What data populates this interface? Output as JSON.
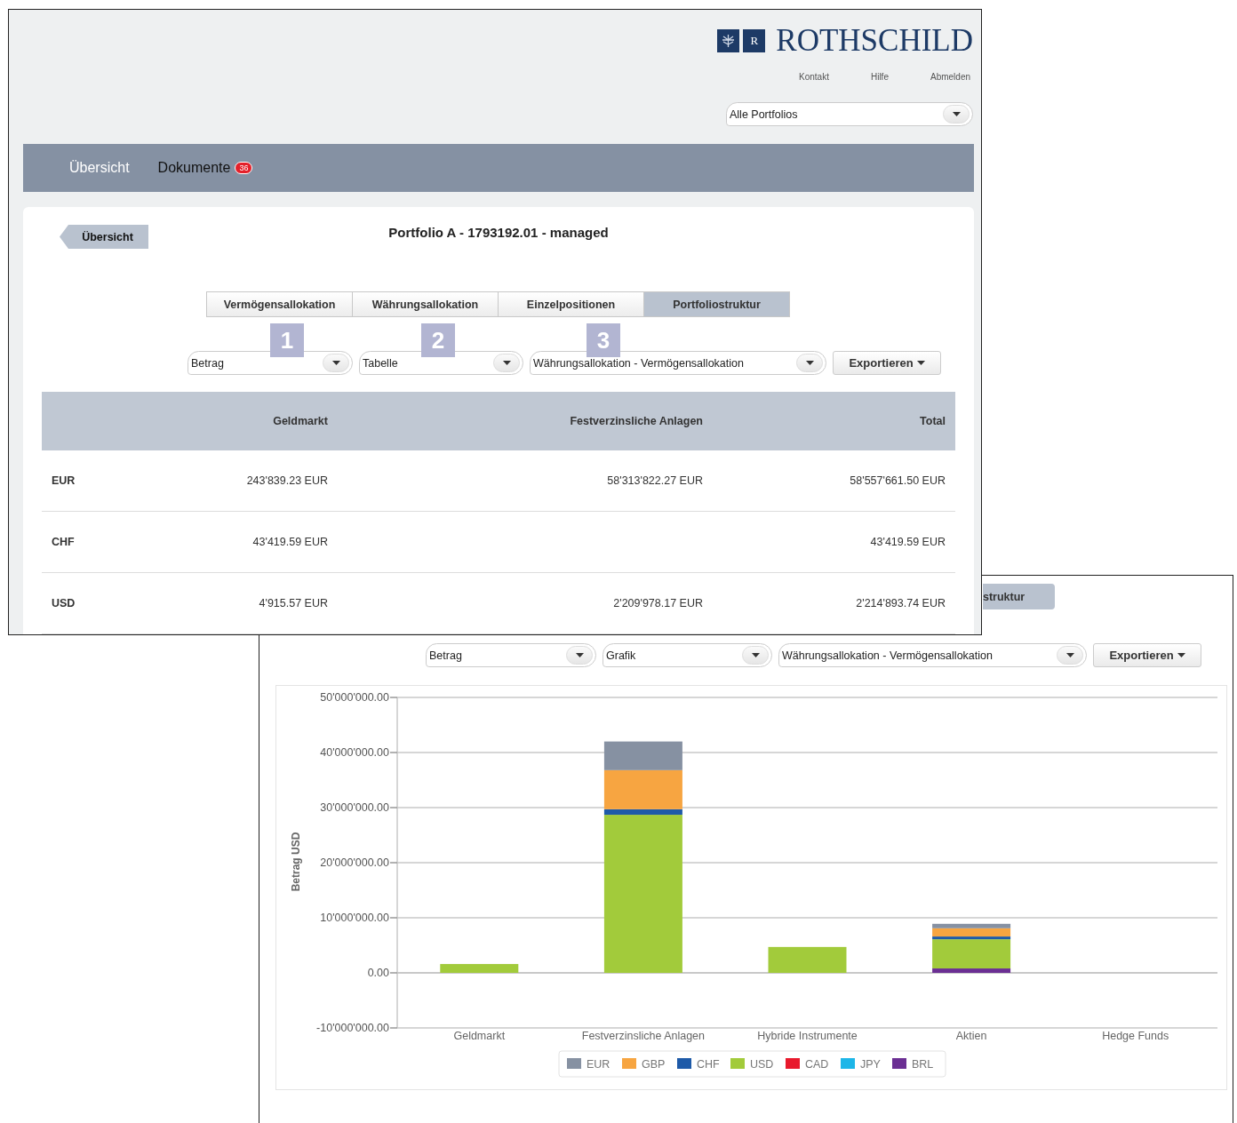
{
  "front_window": {
    "logo": {
      "mark": "R",
      "name": "ROTHSCHILD"
    },
    "top_links": [
      "Kontakt",
      "Hilfe",
      "Abmelden"
    ],
    "portfolio_select": {
      "value": "Alle Portfolios"
    },
    "nav": [
      {
        "label": "Übersicht",
        "selected": true
      },
      {
        "label": "Dokumente",
        "badge": "36",
        "selected": false
      }
    ],
    "back_button": "Übersicht",
    "title": "Portfolio A - 1793192.01 - managed",
    "tabs": [
      {
        "label": "Vermögensallokation",
        "selected": false
      },
      {
        "label": "Währungsallokation",
        "selected": false
      },
      {
        "label": "Einzelpositionen",
        "selected": false
      },
      {
        "label": "Portfoliostruktur",
        "selected": true
      }
    ],
    "markers": [
      "1",
      "2",
      "3"
    ],
    "controls": {
      "selects": [
        "Betrag",
        "Tabelle",
        "Währungsallokation - Vermögensallokation"
      ],
      "export_button": "Exportieren"
    },
    "table": {
      "columns": [
        "",
        "Geldmarkt",
        "Festverzinsliche Anlagen",
        "Total"
      ],
      "rows": [
        [
          "EUR",
          "243'839.23 EUR",
          "58'313'822.27 EUR",
          "58'557'661.50 EUR"
        ],
        [
          "CHF",
          "43'419.59 EUR",
          "",
          "43'419.59 EUR"
        ],
        [
          "USD",
          "4'915.57 EUR",
          "2'209'978.17 EUR",
          "2'214'893.74 EUR"
        ]
      ]
    }
  },
  "back_window": {
    "tab_fragment": {
      "label": "struktur",
      "selected": true
    },
    "controls": {
      "selects": [
        "Betrag",
        "Grafik",
        "Währungsallokation - Vermögensallokation"
      ],
      "export_button": "Exportieren"
    },
    "chart_data": {
      "type": "bar",
      "stacked": true,
      "grid": true,
      "legend": true,
      "ylabel": "Betrag USD",
      "categories": [
        "Geldmarkt",
        "Festverzinsliche Anlagen",
        "Hybride Instrumente",
        "Aktien",
        "Hedge Funds"
      ],
      "series": [
        {
          "name": "EUR",
          "color": "#8691a2",
          "values": [
            0,
            5200000,
            0,
            800000,
            0
          ]
        },
        {
          "name": "GBP",
          "color": "#f7a541",
          "values": [
            0,
            7100000,
            0,
            1500000,
            0
          ]
        },
        {
          "name": "CHF",
          "color": "#1e5aa8",
          "values": [
            0,
            1000000,
            0,
            500000,
            0
          ]
        },
        {
          "name": "USD",
          "color": "#a2cb3b",
          "values": [
            1600000,
            28700000,
            4700000,
            5300000,
            0
          ]
        },
        {
          "name": "CAD",
          "color": "#e8192c",
          "values": [
            0,
            0,
            0,
            0,
            0
          ]
        },
        {
          "name": "JPY",
          "color": "#1db6e8",
          "values": [
            0,
            0,
            0,
            0,
            0
          ]
        },
        {
          "name": "BRL",
          "color": "#6b2f93",
          "values": [
            0,
            0,
            0,
            800000,
            0
          ]
        }
      ],
      "ylim": [
        -10000000,
        50000000
      ],
      "yticks": [
        {
          "value": 50000000,
          "label": "50'000'000.00"
        },
        {
          "value": 40000000,
          "label": "40'000'000.00"
        },
        {
          "value": 30000000,
          "label": "30'000'000.00"
        },
        {
          "value": 20000000,
          "label": "20'000'000.00"
        },
        {
          "value": 10000000,
          "label": "10'000'000.00"
        },
        {
          "value": 0,
          "label": "0.00"
        },
        {
          "value": -10000000,
          "label": "-10'000'000.00"
        }
      ]
    }
  }
}
